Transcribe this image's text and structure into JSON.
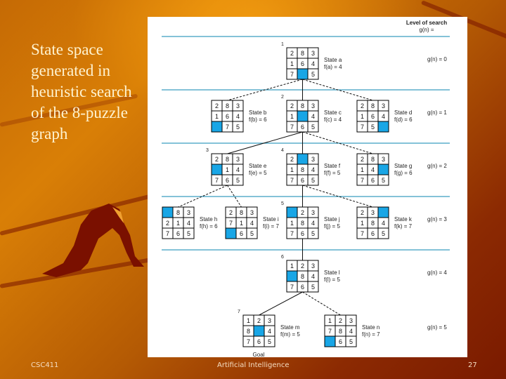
{
  "slide": {
    "title": "State space generated in heuristic search of the 8-puzzle graph",
    "footer_left": "CSC411",
    "footer_center": "Artificial Intelligence",
    "footer_right": "27"
  },
  "diagram": {
    "header_line1": "Level of search",
    "header_line2": "g(n) =",
    "colors": {
      "blank": "#19a6e6",
      "divider": "#3a9ec0",
      "grid": "#000000"
    },
    "levels": [
      "g(n) = 0",
      "g(n) = 1",
      "g(n) = 2",
      "g(n) = 3",
      "g(n) = 4",
      "g(n) = 5"
    ],
    "goal_label": "Goal",
    "states": [
      {
        "id": "a",
        "order": "1",
        "name": "State a",
        "f": "f(a) = 4",
        "tiles": [
          2,
          8,
          3,
          1,
          6,
          4,
          7,
          0,
          5
        ]
      },
      {
        "id": "b",
        "order": "",
        "name": "State b",
        "f": "f(b) = 6",
        "tiles": [
          2,
          8,
          3,
          1,
          6,
          4,
          0,
          7,
          5
        ]
      },
      {
        "id": "c",
        "order": "2",
        "name": "State c",
        "f": "f(c) = 4",
        "tiles": [
          2,
          8,
          3,
          1,
          0,
          4,
          7,
          6,
          5
        ]
      },
      {
        "id": "d",
        "order": "",
        "name": "State d",
        "f": "f(d) = 6",
        "tiles": [
          2,
          8,
          3,
          1,
          6,
          4,
          7,
          5,
          0
        ]
      },
      {
        "id": "e",
        "order": "3",
        "name": "State e",
        "f": "f(e) = 5",
        "tiles": [
          2,
          8,
          3,
          0,
          1,
          4,
          7,
          6,
          5
        ]
      },
      {
        "id": "f",
        "order": "4",
        "name": "State f",
        "f": "f(f) = 5",
        "tiles": [
          2,
          0,
          3,
          1,
          8,
          4,
          7,
          6,
          5
        ]
      },
      {
        "id": "g",
        "order": "",
        "name": "State g",
        "f": "f(g) = 6",
        "tiles": [
          2,
          8,
          3,
          1,
          4,
          0,
          7,
          6,
          5
        ]
      },
      {
        "id": "h",
        "order": "",
        "name": "State h",
        "f": "f(h) = 6",
        "tiles": [
          0,
          8,
          3,
          2,
          1,
          4,
          7,
          6,
          5
        ]
      },
      {
        "id": "i",
        "order": "",
        "name": "State i",
        "f": "f(i) = 7",
        "tiles": [
          2,
          8,
          3,
          7,
          1,
          4,
          0,
          6,
          5
        ]
      },
      {
        "id": "j",
        "order": "5",
        "name": "State j",
        "f": "f(j) = 5",
        "tiles": [
          0,
          2,
          3,
          1,
          8,
          4,
          7,
          6,
          5
        ]
      },
      {
        "id": "k",
        "order": "",
        "name": "State k",
        "f": "f(k) = 7",
        "tiles": [
          2,
          3,
          0,
          1,
          8,
          4,
          7,
          6,
          5
        ]
      },
      {
        "id": "l",
        "order": "6",
        "name": "State l",
        "f": "f(l) = 5",
        "tiles": [
          1,
          2,
          3,
          0,
          8,
          4,
          7,
          6,
          5
        ]
      },
      {
        "id": "m",
        "order": "7",
        "name": "State m",
        "f": "f(m) = 5",
        "tiles": [
          1,
          2,
          3,
          8,
          0,
          4,
          7,
          6,
          5
        ]
      },
      {
        "id": "n",
        "order": "",
        "name": "State n",
        "f": "f(n) = 7",
        "tiles": [
          1,
          2,
          3,
          7,
          8,
          4,
          0,
          6,
          5
        ]
      }
    ],
    "edges": [
      {
        "from": "a",
        "to": "b",
        "style": "dashed"
      },
      {
        "from": "a",
        "to": "c",
        "style": "solid"
      },
      {
        "from": "a",
        "to": "d",
        "style": "dashed"
      },
      {
        "from": "c",
        "to": "e",
        "style": "solid"
      },
      {
        "from": "c",
        "to": "f",
        "style": "solid"
      },
      {
        "from": "c",
        "to": "g",
        "style": "dashed"
      },
      {
        "from": "e",
        "to": "h",
        "style": "dashed"
      },
      {
        "from": "e",
        "to": "i",
        "style": "dashed"
      },
      {
        "from": "f",
        "to": "j",
        "style": "solid"
      },
      {
        "from": "f",
        "to": "k",
        "style": "dashed"
      },
      {
        "from": "j",
        "to": "l",
        "style": "solid"
      },
      {
        "from": "l",
        "to": "m",
        "style": "solid"
      },
      {
        "from": "l",
        "to": "n",
        "style": "dashed"
      }
    ]
  }
}
